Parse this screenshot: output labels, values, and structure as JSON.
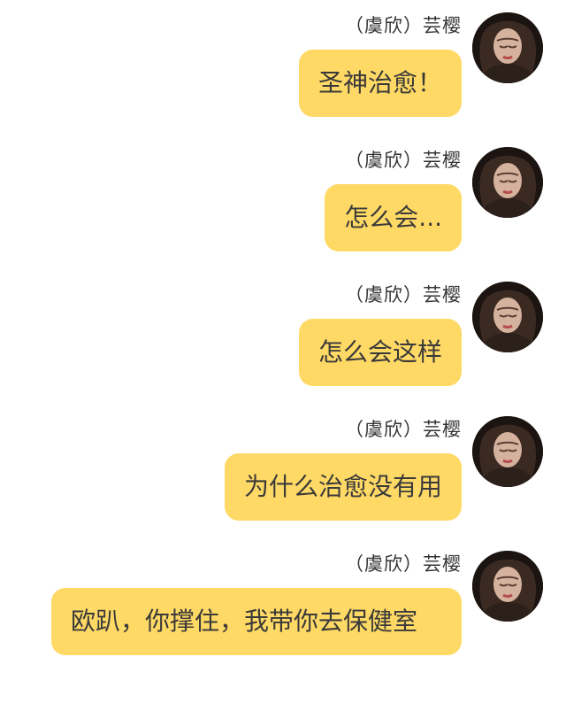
{
  "messages": [
    {
      "sender": "（虞欣）芸樱",
      "text": "圣神治愈！"
    },
    {
      "sender": "（虞欣）芸樱",
      "text": "怎么会..."
    },
    {
      "sender": "（虞欣）芸樱",
      "text": "怎么会这样"
    },
    {
      "sender": "（虞欣）芸樱",
      "text": "为什么治愈没有用"
    },
    {
      "sender": "（虞欣）芸樱",
      "text": "欧趴，你撑住，我带你去保健室"
    }
  ],
  "colors": {
    "bubble": "#ffd965",
    "text": "#3a3a3a",
    "name": "#333333"
  },
  "icons": {
    "avatar": "profile-avatar-icon"
  }
}
